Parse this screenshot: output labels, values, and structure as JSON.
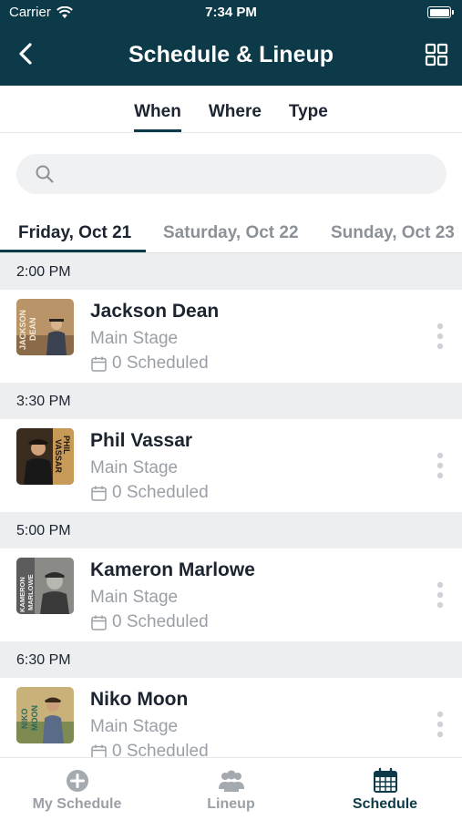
{
  "status": {
    "carrier": "Carrier",
    "time": "7:34 PM"
  },
  "nav": {
    "title": "Schedule & Lineup"
  },
  "filters": [
    "When",
    "Where",
    "Type"
  ],
  "search": {
    "placeholder": ""
  },
  "days": [
    "Friday, Oct 21",
    "Saturday, Oct 22",
    "Sunday, Oct 23"
  ],
  "slots": [
    {
      "time": "2:00 PM",
      "artist": "Jackson Dean",
      "stage": "Main Stage",
      "scheduled": "0 Scheduled",
      "thumb_text": "JACKSON DEAN"
    },
    {
      "time": "3:30 PM",
      "artist": "Phil Vassar",
      "stage": "Main Stage",
      "scheduled": "0 Scheduled",
      "thumb_text": "PHIL VASSAR"
    },
    {
      "time": "5:00 PM",
      "artist": "Kameron Marlowe",
      "stage": "Main Stage",
      "scheduled": "0 Scheduled",
      "thumb_text": "KAMERON MARLOWE"
    },
    {
      "time": "6:30 PM",
      "artist": "Niko Moon",
      "stage": "Main Stage",
      "scheduled": "0 Scheduled",
      "thumb_text": "NIKO MOON"
    }
  ],
  "tabbar": {
    "my_schedule": "My Schedule",
    "lineup": "Lineup",
    "schedule": "Schedule"
  },
  "colors": {
    "header": "#0c3a48",
    "muted": "#9aa0a6",
    "section_bg": "#eceef0"
  }
}
